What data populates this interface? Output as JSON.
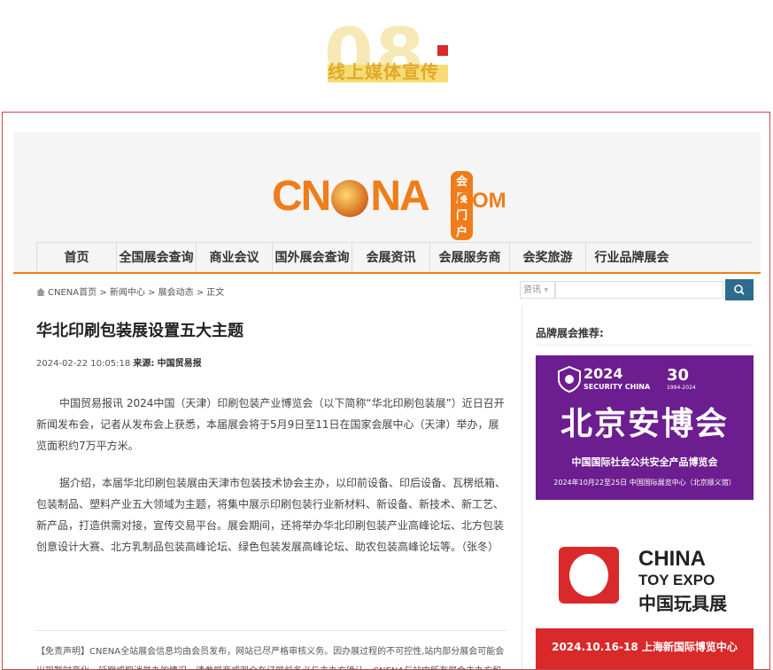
{
  "banner": {
    "number": "08",
    "title": "线上媒体宣传"
  },
  "site": {
    "logo_text": "CNENA",
    "logo_badge": "会展门户",
    "logo_com": ".COM"
  },
  "nav": [
    "首页",
    "全国展会查询",
    "商业会议",
    "国外展会查询",
    "会展资讯",
    "会展服务商",
    "会奖旅游",
    "行业品牌展会"
  ],
  "breadcrumb": "CNENA首页 > 新闻中心 > 展会动态 > 正文",
  "search": {
    "category": "资讯",
    "placeholder": ""
  },
  "article": {
    "title": "华北印刷包装展设置五大主题",
    "date": "2024-02-22 10:05:18",
    "source_label": "来源:",
    "source": "中国贸易报",
    "paragraphs": [
      "中国贸易报讯 2024中国（天津）印刷包装产业博览会（以下简称“华北印刷包装展”）近日召开新闻发布会，记者从发布会上获悉，本届展会将于5月9日至11日在国家会展中心（天津）举办，展览面积约7万平方米。",
      "据介绍，本届华北印刷包装展由天津市包装技术协会主办，以印前设备、印后设备、瓦楞纸箱、包装制品、塑料产业五大领域为主题，将集中展示印刷包装行业新材料、新设备、新技术、新工艺、新产品，打造供需对接，宣传交易平台。展会期间，还将举办华北印刷包装产业高峰论坛、北方包装创意设计大赛、北方乳制品包装高峰论坛、绿色包装发展高峰论坛、助农包装高峰论坛等。（张冬）"
    ],
    "disclaimer": "【免责声明】CNENA全站展会信息均由会员发布，网站已尽严格审核义务。因办展过程的不可控性,站内部分展会可能会出现暂时变化，延期或取消举办的情况，请参展商或观众在订展前务必与主办方确认，CNENA与站内所有展会主办方和合作机构均无关联。"
  },
  "side": {
    "title": "品牌展会推荐:",
    "ad1": {
      "year": "2024",
      "brand": "SECURITY CHINA",
      "anniv": "30",
      "anniv_years": "1994-2024",
      "main": "北京安博会",
      "sub": "中国国际社会公共安全产品博览会",
      "date": "2024年10月22至25日 中国国际展览中心（北京顺义馆）"
    },
    "ad2": {
      "en1": "CHINA",
      "en2": "TOY EXPO",
      "cn": "中国玩具展",
      "date": "2024.10.16-18 上海新国际博览中心"
    }
  },
  "colors": {
    "accent": "#ef7d1a",
    "frame": "#c8484d",
    "ad_purple": "#6c1d8f",
    "ad_red": "#d9292a"
  }
}
